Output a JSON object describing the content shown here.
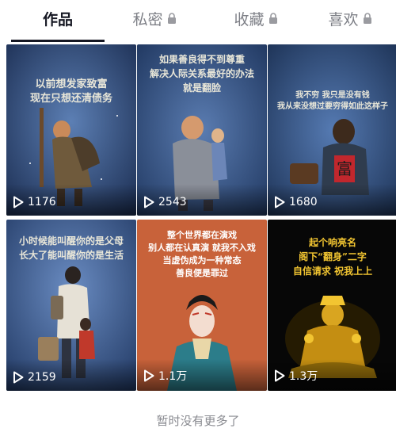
{
  "tabs": [
    {
      "label": "作品",
      "active": true,
      "locked": false
    },
    {
      "label": "私密",
      "active": false,
      "locked": true
    },
    {
      "label": "收藏",
      "active": false,
      "locked": true
    },
    {
      "label": "喜欢",
      "active": false,
      "locked": true
    }
  ],
  "videos": [
    {
      "caption": "以前想发家致富\n现在只想还清债务",
      "plays": "1176",
      "theme": "blue-night",
      "caption_color": "#e8e6d8"
    },
    {
      "caption": "如果善良得不到尊重\n解决人际关系最好的办法\n就是翻脸",
      "plays": "2543",
      "theme": "blue-night",
      "caption_color": "#e8e6d8"
    },
    {
      "caption": "我不穷 我只是没有钱\n我从来没想过要穷得如此这样子",
      "plays": "1680",
      "theme": "blue-night",
      "caption_color": "#e8e6d8"
    },
    {
      "caption": "小时候能叫醒你的是父母\n长大了能叫醒你的是生活",
      "plays": "2159",
      "theme": "blue-night",
      "caption_color": "#e8e6d8"
    },
    {
      "caption": "整个世界都在演戏\n别人都在认真演 就我不入戏\n当虚伪成为一种常态\n善良便是罪过",
      "plays": "1.1万",
      "theme": "orange-opera",
      "caption_color": "#ffffff"
    },
    {
      "caption": "起个响亮名\n阁下“翻身”二字\n自信请求 祝我上上",
      "plays": "1.3万",
      "theme": "black-gold",
      "caption_color": "#f2c531"
    }
  ],
  "footer": {
    "text": "暂时没有更多了"
  },
  "icons": {
    "lock": "lock-icon",
    "play": "play-icon"
  },
  "colors": {
    "active_tab": "#161823",
    "inactive_tab": "#7d7f86",
    "footer": "#8a8b91"
  }
}
